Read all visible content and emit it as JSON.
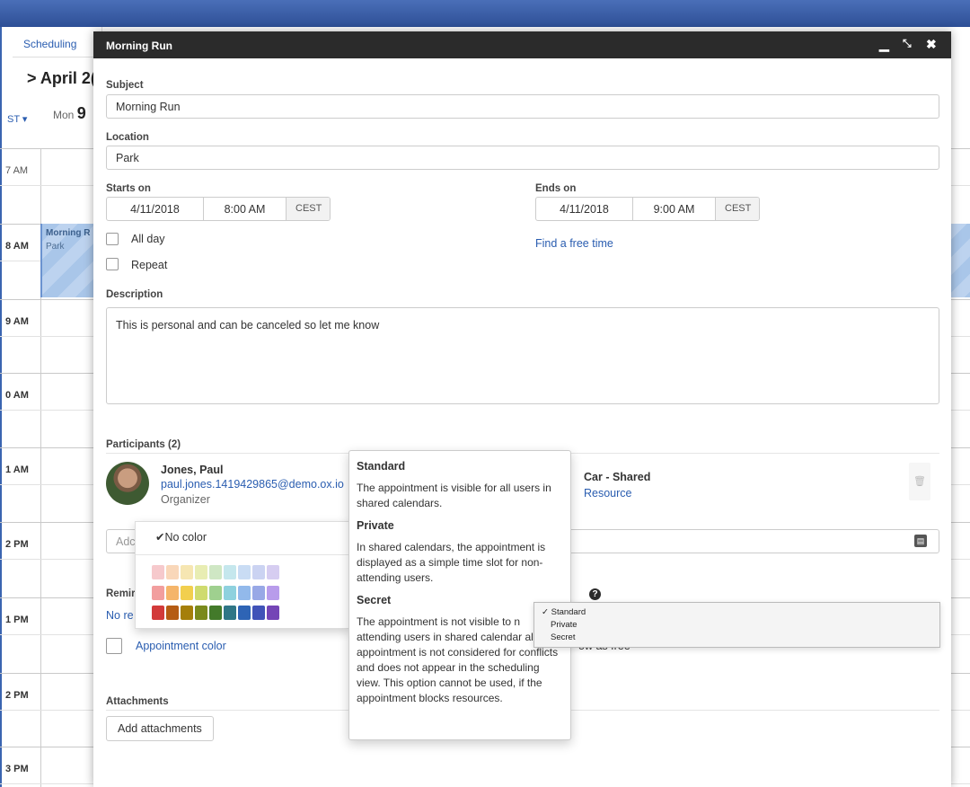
{
  "app": {
    "tab": "Scheduling",
    "nav_title": "April 2(",
    "tz": "ST",
    "day_name": "Mon",
    "day_num": "9"
  },
  "calendar": {
    "times": [
      "7 AM",
      "8 AM",
      "9 AM",
      "0 AM",
      "1 AM",
      "2 PM",
      "1 PM",
      "2 PM",
      "3 PM"
    ],
    "event": {
      "title": "Morning R",
      "location": "Park"
    }
  },
  "dialog": {
    "title": "Morning Run",
    "subject_label": "Subject",
    "subject_value": "Morning Run",
    "location_label": "Location",
    "location_value": "Park",
    "starts_label": "Starts on",
    "start_date": "4/11/2018",
    "start_time": "8:00 AM",
    "start_tz": "CEST",
    "ends_label": "Ends on",
    "end_date": "4/11/2018",
    "end_time": "9:00 AM",
    "end_tz": "CEST",
    "allday_label": "All day",
    "repeat_label": "Repeat",
    "find_free": "Find a free time",
    "description_label": "Description",
    "description_value": "This is personal and can be canceled so let me know",
    "participants_label": "Participants (2)",
    "participant1": {
      "name": "Jones, Paul",
      "email": "paul.jones.1419429865@demo.ox.io",
      "role": "Organizer"
    },
    "participant2": {
      "name": "Car - Shared",
      "role": "Resource"
    },
    "add_placeholder": "Adc",
    "reminder_label": "Remir",
    "reminder_value": "No re",
    "appointment_color": "Appointment color",
    "attachments_label": "Attachments",
    "add_attachments": "Add attachments",
    "show_as_free_fragment": "ow as free"
  },
  "color_picker": {
    "no_color": "No color",
    "rows": [
      [
        "#f6c9cc",
        "#f9d7b9",
        "#f6e6b2",
        "#e8edb3",
        "#cfe7c4",
        "#c5e7ed",
        "#c9dcf4",
        "#cbd3f2",
        "#d6cdf1"
      ],
      [
        "#f29e9e",
        "#f5b56a",
        "#f2cf4e",
        "#cfdb6f",
        "#9fd08f",
        "#8ed1de",
        "#92b9eb",
        "#98a8e6",
        "#b89ceb"
      ],
      [
        "#d23a3a",
        "#b55c13",
        "#a57f0a",
        "#7a8a1c",
        "#437a2a",
        "#2f7686",
        "#2e64b5",
        "#4053b8",
        "#7445b6"
      ]
    ]
  },
  "visibility_help": {
    "standard_title": "Standard",
    "standard_text": "The appointment is visible for all users in shared calendars.",
    "private_title": "Private",
    "private_text": "In shared calendars, the appointment is displayed as a simple time slot for non-attending users.",
    "secret_title": "Secret",
    "secret_text": "The appointment is not visible to n attending users in shared calendar all. The appointment is not considered for conflicts and does not appear in the scheduling view. This option cannot be used, if the appointment blocks resources."
  },
  "visibility_menu": {
    "options": [
      "Standard",
      "Private",
      "Secret"
    ],
    "selected": "Standard"
  }
}
